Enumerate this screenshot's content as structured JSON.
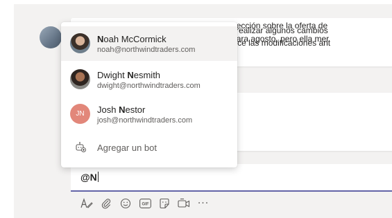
{
  "messages": [
    {
      "line1": "el cliente tuvo que realizar algunos cambios",
      "line2": "para que Josh realice las modificaciones ant"
    },
    {
      "line1": "luye también una sección sobre la oferta de",
      "line2": "o de uno incluida para agosto, pero ella mer"
    }
  ],
  "mention_popup": {
    "suggestions": [
      {
        "name_bold": "N",
        "name_rest": "oah McCormick",
        "email": "noah@northwindtraders.com",
        "avatar": "photo",
        "selected": true
      },
      {
        "name_first": "Dwight ",
        "name_bold": "N",
        "name_rest": "esmith",
        "email": "dwight@northwindtraders.com",
        "avatar": "photo",
        "selected": false
      },
      {
        "name_first": "Josh ",
        "name_bold": "N",
        "name_rest": "estor",
        "email": "josh@northwindtraders.com",
        "avatar_initials": "JN",
        "avatar_color": "#e2877a",
        "selected": false
      }
    ],
    "add_bot": {
      "label": "Agregar un bot",
      "icon": "bot-add-icon"
    }
  },
  "compose": {
    "value": "@N"
  },
  "toolbar": {
    "icons": [
      "format-icon",
      "attach-icon",
      "emoji-icon",
      "gif-icon",
      "sticker-icon",
      "meet-now-icon",
      "more-options-icon"
    ],
    "more_label": "···"
  },
  "colors": {
    "accent": "#6264a7",
    "canvas": "#f3f2f1",
    "text": "#252423",
    "secondary_text": "#605e5c"
  }
}
